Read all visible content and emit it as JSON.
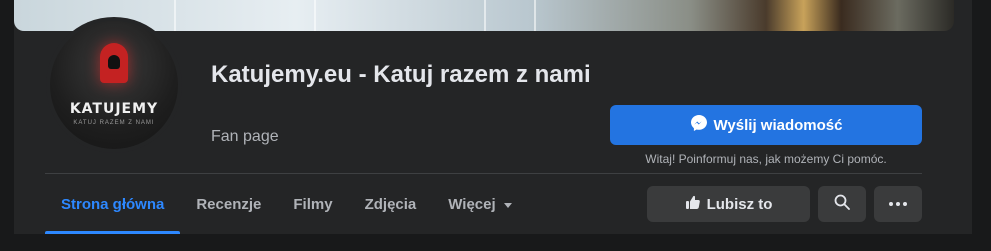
{
  "page": {
    "name": "Katujemy.eu - Katuj razem z nami",
    "category": "Fan page"
  },
  "avatar": {
    "logo_text": "KATUJEMY",
    "logo_subtext": "KATUJ RAZEM Z NAMI"
  },
  "actions": {
    "message_label": "Wyślij wiadomość",
    "message_hint": "Witaj! Poinformuj nas, jak możemy Ci pomóc.",
    "like_label": "Lubisz to"
  },
  "tabs": [
    {
      "label": "Strona główna",
      "active": true
    },
    {
      "label": "Recenzje",
      "active": false
    },
    {
      "label": "Filmy",
      "active": false
    },
    {
      "label": "Zdjęcia",
      "active": false
    },
    {
      "label": "Więcej",
      "active": false
    }
  ],
  "icons": {
    "messenger": "messenger-icon",
    "like": "thumbs-up-icon",
    "search": "search-icon",
    "more": "more-icon",
    "dropdown": "caret-down-icon"
  },
  "colors": {
    "accent": "#2374e1",
    "active_tab": "#2d88ff",
    "surface": "#242526",
    "background": "#18191a"
  }
}
